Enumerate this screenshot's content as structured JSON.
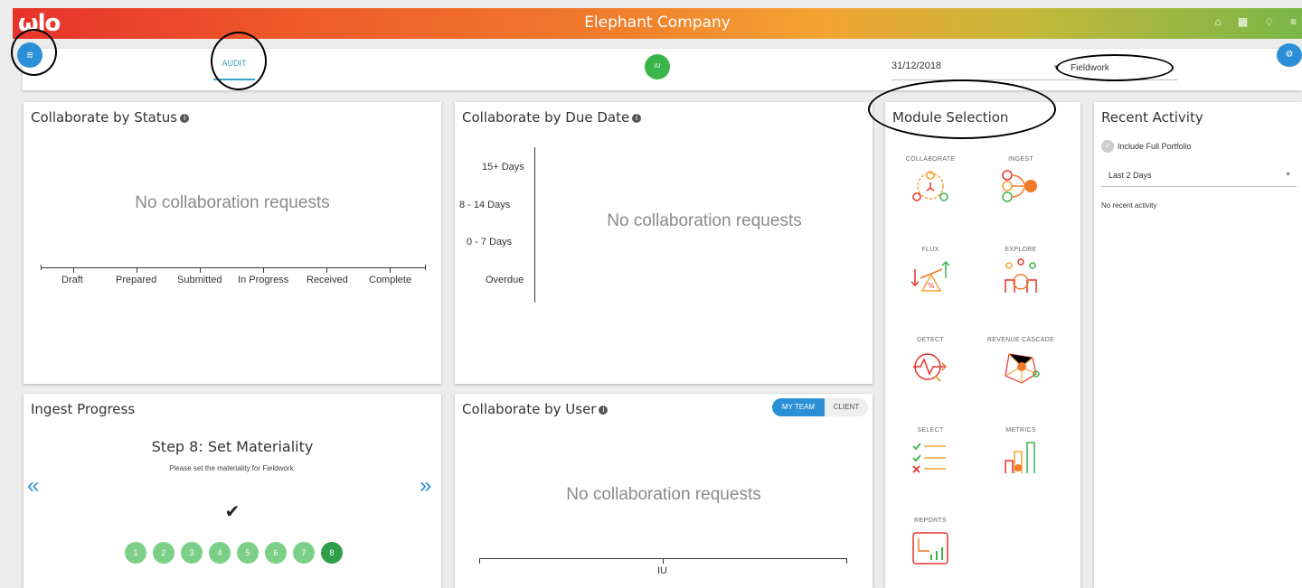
{
  "topbar": {
    "logo": "ωlo",
    "title": "Elephant Company",
    "icons": [
      "home-icon",
      "book-icon",
      "bell-icon",
      "menu-icon"
    ]
  },
  "subbar": {
    "audit_tab": "AUDIT",
    "user_initials": "IU",
    "date_value": "31/12/2018",
    "phase_value": "Fieldwork"
  },
  "status_card": {
    "title": "Collaborate by Status",
    "empty": "No collaboration requests",
    "categories": [
      "Draft",
      "Prepared",
      "Submitted",
      "In Progress",
      "Received",
      "Complete"
    ]
  },
  "due_card": {
    "title": "Collaborate by Due Date",
    "empty": "No collaboration requests",
    "categories": [
      "15+ Days",
      "8 - 14 Days",
      "0 - 7 Days",
      "Overdue"
    ]
  },
  "ingest_card": {
    "title": "Ingest Progress",
    "step_title": "Step 8: Set Materiality",
    "step_desc": "Please set the materiality for Fieldwork.",
    "steps": [
      "1",
      "2",
      "3",
      "4",
      "5",
      "6",
      "7",
      "8"
    ],
    "active_step": 8
  },
  "user_card": {
    "title": "Collaborate by User",
    "empty": "No collaboration requests",
    "toggle_on": "MY TEAM",
    "toggle_off": "CLIENT",
    "axis_label": "IU"
  },
  "modules": {
    "title": "Module Selection",
    "items": [
      "COLLABORATE",
      "INGEST",
      "FLUX",
      "EXPLORE",
      "DETECT",
      "REVENUE CASCADE",
      "SELECT",
      "METRICS",
      "REPORTS"
    ]
  },
  "recent": {
    "title": "Recent Activity",
    "include_label": "Include Full Portfolio",
    "range": "Last 2 Days",
    "empty": "No recent activity"
  },
  "colors": {
    "brand_blue": "#2a8fd6",
    "green": "#3ab54a",
    "red": "#e8322c",
    "orange": "#f5a233"
  }
}
